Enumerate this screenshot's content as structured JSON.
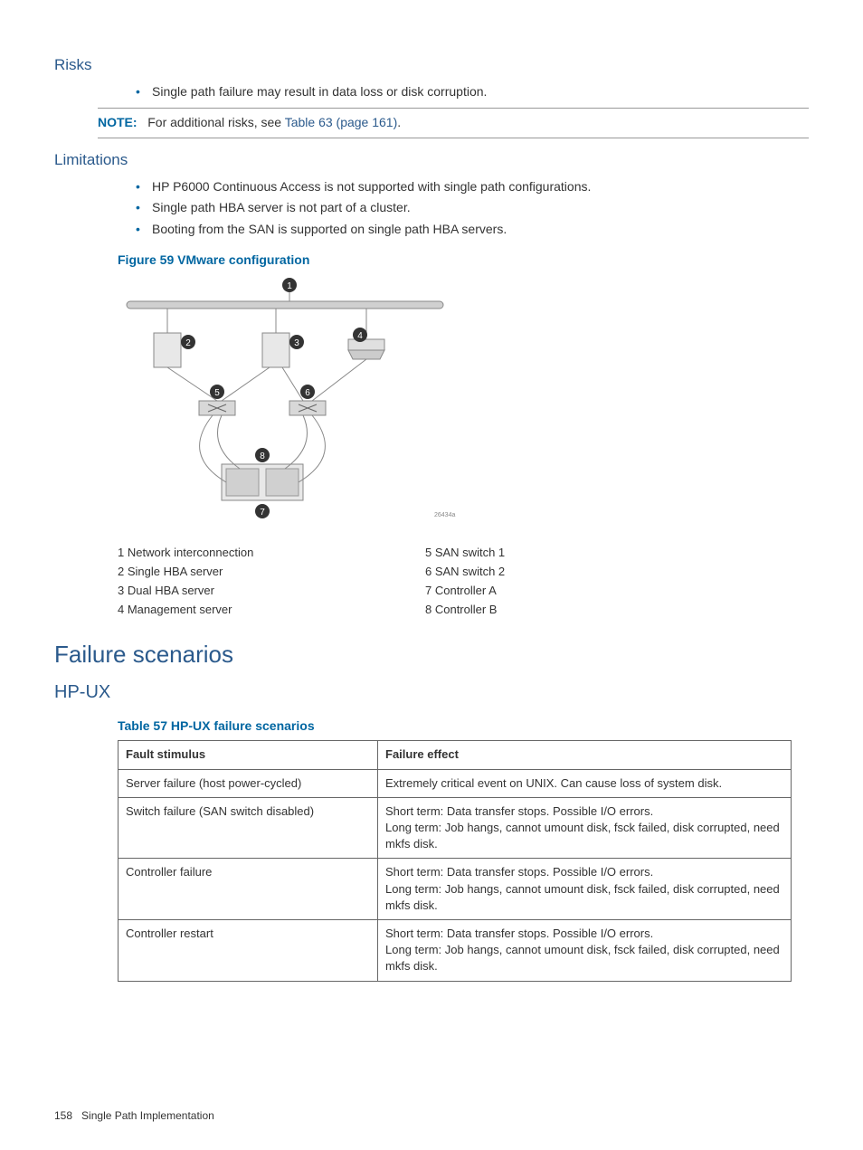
{
  "risks": {
    "heading": "Risks",
    "items": [
      "Single path failure may result in data loss or disk corruption."
    ]
  },
  "note": {
    "label": "NOTE:",
    "text_before": "For additional risks, see ",
    "link": "Table 63 (page 161)",
    "text_after": "."
  },
  "limitations": {
    "heading": "Limitations",
    "items": [
      "HP P6000 Continuous Access is not supported with single path configurations.",
      "Single path HBA server is not part of a cluster.",
      "Booting from the SAN is supported on single path HBA servers."
    ]
  },
  "figure": {
    "caption": "Figure 59 VMware configuration",
    "id": "26434a"
  },
  "legend": {
    "left": [
      "1 Network interconnection",
      "2 Single HBA server",
      "3 Dual HBA server",
      "4 Management server"
    ],
    "right": [
      "5 SAN switch 1",
      "6 SAN switch 2",
      "7 Controller A",
      "8 Controller B"
    ]
  },
  "failure": {
    "heading": "Failure scenarios",
    "sub": "HP-UX"
  },
  "table": {
    "caption": "Table 57 HP-UX failure scenarios",
    "headers": [
      "Fault stimulus",
      "Failure effect"
    ],
    "rows": [
      {
        "c0": "Server failure (host power-cycled)",
        "c1": "Extremely critical event on UNIX. Can cause loss of system disk."
      },
      {
        "c0": "Switch failure (SAN switch disabled)",
        "c1": "Short term: Data transfer stops. Possible I/O errors.\nLong term: Job hangs, cannot umount disk, fsck failed, disk corrupted, need mkfs disk."
      },
      {
        "c0": "Controller failure",
        "c1": "Short term: Data transfer stops. Possible I/O errors.\nLong term: Job hangs, cannot umount disk, fsck failed, disk corrupted, need mkfs disk."
      },
      {
        "c0": "Controller restart",
        "c1": "Short term: Data transfer stops. Possible I/O errors.\nLong term: Job hangs, cannot umount disk, fsck failed, disk corrupted, need mkfs disk."
      }
    ]
  },
  "footer": {
    "page": "158",
    "title": "Single Path Implementation"
  }
}
